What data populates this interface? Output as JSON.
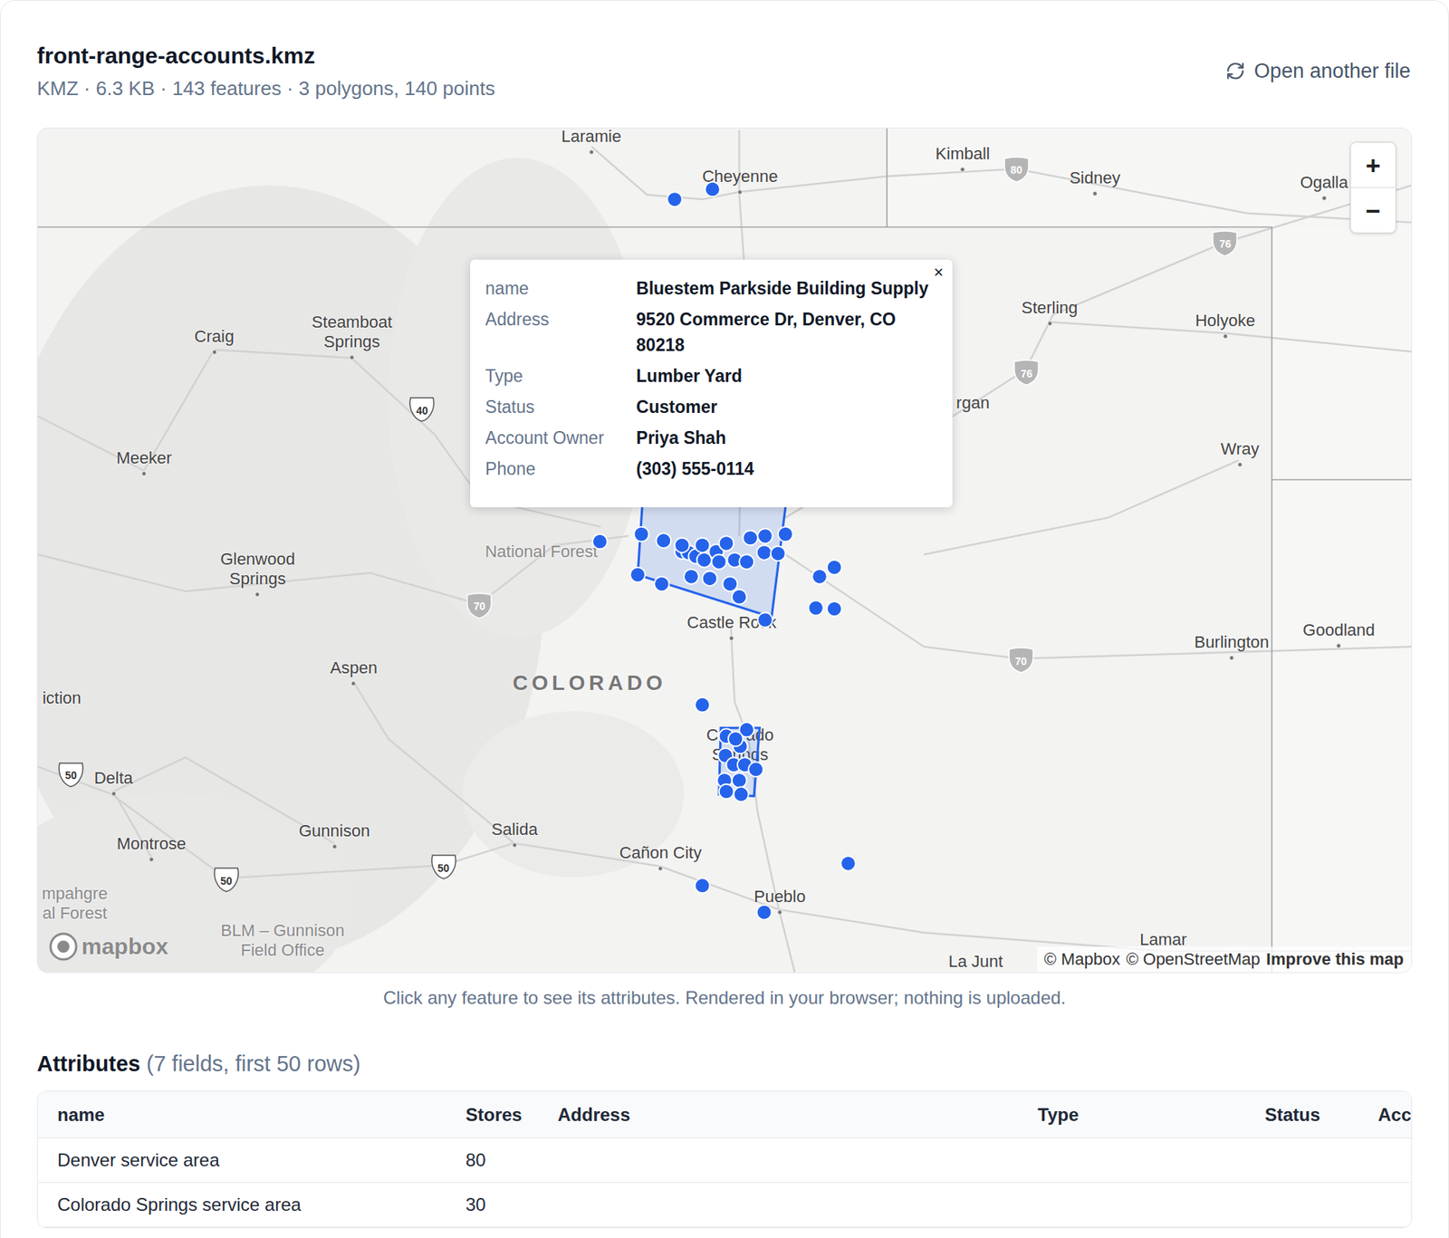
{
  "file": {
    "name": "front-range-accounts.kmz",
    "summary": "KMZ · 6.3 KB · 143 features · 3 polygons, 140 points",
    "open_button": "Open another file"
  },
  "map": {
    "zoom": {
      "in": "+",
      "out": "−"
    },
    "labels": [
      {
        "lines": [
          "Laramie"
        ],
        "kind": "city"
      },
      {
        "lines": [
          "Cheyenne"
        ],
        "kind": "city"
      },
      {
        "lines": [
          "Kimball"
        ],
        "kind": "city"
      },
      {
        "lines": [
          "Sidney"
        ],
        "kind": "city"
      },
      {
        "lines": [
          "Ogalla"
        ],
        "kind": "city"
      },
      {
        "lines": [
          "Sterling"
        ],
        "kind": "city"
      },
      {
        "lines": [
          "Holyoke"
        ],
        "kind": "city"
      },
      {
        "lines": [
          "rgan"
        ],
        "kind": "place"
      },
      {
        "lines": [
          "Wray"
        ],
        "kind": "city"
      },
      {
        "lines": [
          "Craig"
        ],
        "kind": "city"
      },
      {
        "lines": [
          "Steamboat",
          "Springs"
        ],
        "kind": "city"
      },
      {
        "lines": [
          "Meeker"
        ],
        "kind": "city"
      },
      {
        "lines": [
          "Glenwood",
          "Springs"
        ],
        "kind": "city"
      },
      {
        "lines": [
          "National Forest"
        ],
        "kind": "region"
      },
      {
        "lines": [
          "Castle Rock"
        ],
        "kind": "city"
      },
      {
        "lines": [
          "Aspen"
        ],
        "kind": "city"
      },
      {
        "lines": [
          "COLORADO"
        ],
        "kind": "state"
      },
      {
        "lines": [
          "iction"
        ],
        "kind": "place"
      },
      {
        "lines": [
          "Burlington"
        ],
        "kind": "city"
      },
      {
        "lines": [
          "Goodland"
        ],
        "kind": "city"
      },
      {
        "lines": [
          "Delta"
        ],
        "kind": "city"
      },
      {
        "lines": [
          "Montrose"
        ],
        "kind": "city"
      },
      {
        "lines": [
          "Gunnison"
        ],
        "kind": "city"
      },
      {
        "lines": [
          "Salida"
        ],
        "kind": "city"
      },
      {
        "lines": [
          "Cañon City"
        ],
        "kind": "city"
      },
      {
        "lines": [
          "Pueblo"
        ],
        "kind": "city"
      },
      {
        "lines": [
          "Colorado",
          "Springs"
        ],
        "kind": "place"
      },
      {
        "lines": [
          "Lamar"
        ],
        "kind": "place"
      },
      {
        "lines": [
          "La Junt"
        ],
        "kind": "place"
      },
      {
        "lines": [
          "mpahgre",
          "al Forest"
        ],
        "kind": "region"
      },
      {
        "lines": [
          "BLM – Gunnison",
          "Field Office"
        ],
        "kind": "region"
      }
    ],
    "shields": [
      {
        "text": "80",
        "kind": "interstate"
      },
      {
        "text": "76",
        "kind": "interstate"
      },
      {
        "text": "76",
        "kind": "interstate"
      },
      {
        "text": "40",
        "kind": "us"
      },
      {
        "text": "70",
        "kind": "interstate"
      },
      {
        "text": "70",
        "kind": "interstate"
      },
      {
        "text": "50",
        "kind": "us"
      },
      {
        "text": "50",
        "kind": "us"
      },
      {
        "text": "50",
        "kind": "us"
      }
    ],
    "logo": "mapbox",
    "attribution": [
      {
        "text": "© Mapbox",
        "bold": false
      },
      {
        "text": "© OpenStreetMap",
        "bold": false
      },
      {
        "text": "Improve this map",
        "bold": true
      }
    ],
    "popup": {
      "close": "×",
      "fields": [
        {
          "key": "name",
          "value": "Bluestem Parkside Building Supply"
        },
        {
          "key": "Address",
          "value": "9520 Commerce Dr, Denver, CO 80218"
        },
        {
          "key": "Type",
          "value": "Lumber Yard"
        },
        {
          "key": "Status",
          "value": "Customer"
        },
        {
          "key": "Account Owner",
          "value": "Priya Shah"
        },
        {
          "key": "Phone",
          "value": "(303) 555-0114"
        }
      ]
    }
  },
  "caption": "Click any feature to see its attributes. Rendered in your browser; nothing is uploaded.",
  "attributes": {
    "title": "Attributes",
    "meta": "(7 fields, first 50 rows)",
    "columns": [
      "name",
      "Stores",
      "Address",
      "Type",
      "Status",
      "Acc"
    ],
    "rows": [
      [
        "Denver service area",
        "80",
        "",
        "",
        "",
        ""
      ],
      [
        "Colorado Springs service area",
        "30",
        "",
        "",
        "",
        ""
      ]
    ]
  }
}
